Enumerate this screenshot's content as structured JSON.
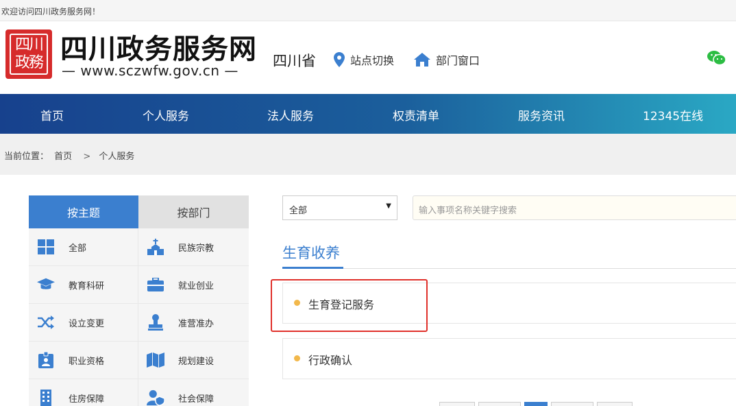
{
  "topbar": {
    "welcome": "欢迎访问四川政务服务网！"
  },
  "header": {
    "logo_seal_text": "四川\n政務",
    "site_name": "四川政务服务网",
    "site_url": "— www.sczwfw.gov.cn —",
    "province": "四川省",
    "links": [
      {
        "label": "站点切换",
        "icon": "location-pin-icon"
      },
      {
        "label": "部门窗口",
        "icon": "home-icon"
      }
    ],
    "wechat_icon": "wechat-icon"
  },
  "nav": {
    "items": [
      {
        "label": "首页"
      },
      {
        "label": "个人服务"
      },
      {
        "label": "法人服务"
      },
      {
        "label": "权责清单"
      },
      {
        "label": "服务资讯"
      },
      {
        "label": "12345在线"
      }
    ]
  },
  "breadcrumb": {
    "prefix": "当前位置：",
    "items": [
      "首页",
      "个人服务"
    ],
    "separator": ">"
  },
  "sidebar": {
    "tabs": [
      {
        "label": "按主题",
        "active": true
      },
      {
        "label": "按部门",
        "active": false
      }
    ],
    "categories": [
      {
        "label": "全部",
        "icon": "grid-icon"
      },
      {
        "label": "民族宗教",
        "icon": "church-icon"
      },
      {
        "label": "教育科研",
        "icon": "graduation-cap-icon"
      },
      {
        "label": "就业创业",
        "icon": "briefcase-icon"
      },
      {
        "label": "设立变更",
        "icon": "shuffle-icon"
      },
      {
        "label": "准营准办",
        "icon": "stamp-icon"
      },
      {
        "label": "职业资格",
        "icon": "id-card-icon"
      },
      {
        "label": "规划建设",
        "icon": "map-icon"
      },
      {
        "label": "住房保障",
        "icon": "building-icon"
      },
      {
        "label": "社会保障",
        "icon": "user-shield-icon"
      }
    ]
  },
  "main": {
    "select": {
      "value": "全部"
    },
    "search": {
      "placeholder": "输入事项名称关键字搜索"
    },
    "section_title": "生育收养",
    "services": [
      {
        "label": "生育登记服务"
      },
      {
        "label": "行政确认"
      }
    ]
  },
  "colors": {
    "accent": "#3b7fcf",
    "nav_gradient_start": "#17418d",
    "nav_gradient_end": "#2aa8c4",
    "seal": "#d62b2b",
    "highlight": "#e0302a",
    "dot": "#f2b84b"
  }
}
